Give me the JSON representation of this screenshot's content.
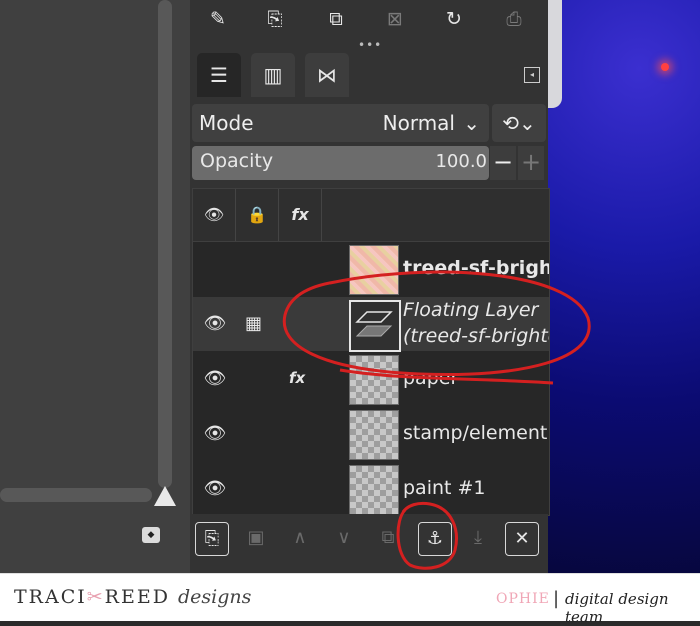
{
  "toolbar": {
    "icons": [
      "edit-layer-attributes-icon",
      "new-layer-icon",
      "duplicate-layer-icon",
      "delete-layer-icon",
      "refresh-icon",
      "export-icon"
    ]
  },
  "tabs": [
    "layers-tab",
    "channels-tab",
    "paths-tab"
  ],
  "mode": {
    "label": "Mode",
    "value": "Normal"
  },
  "opacity": {
    "label": "Opacity",
    "value": "100.0",
    "minus": "−",
    "plus": "+"
  },
  "layers_header": {
    "visibility": "👁",
    "lock": "🔒",
    "fx": "fx"
  },
  "layers": [
    {
      "name": "treed-sf-bright",
      "visible": false,
      "fx": false,
      "thumb": "pink",
      "style": "bold"
    },
    {
      "name_line1": "Floating Layer",
      "name_line2": "(treed-sf-brighte",
      "visible": true,
      "thumb": "float",
      "style": "italic"
    },
    {
      "name": "paper",
      "visible": true,
      "fx": true,
      "thumb": "checker"
    },
    {
      "name": "stamp/element",
      "visible": true,
      "fx": false,
      "thumb": "checker"
    },
    {
      "name": "paint #1",
      "visible": true,
      "fx": false,
      "thumb": "checker"
    }
  ],
  "bottom_buttons": [
    "new-layer",
    "new-layer-group",
    "raise-layer",
    "lower-layer",
    "duplicate-layer",
    "anchor-layer",
    "merge-layer",
    "delete-layer"
  ],
  "footer": {
    "brand_left": "TRACI",
    "brand_mid": "REED",
    "brand_script": "designs",
    "ophie": "OPHIE",
    "separator": "|",
    "team": "digital design team"
  },
  "colors": {
    "annotation_red": "#d42020",
    "panel_bg": "#333333",
    "list_bg": "#272727"
  }
}
